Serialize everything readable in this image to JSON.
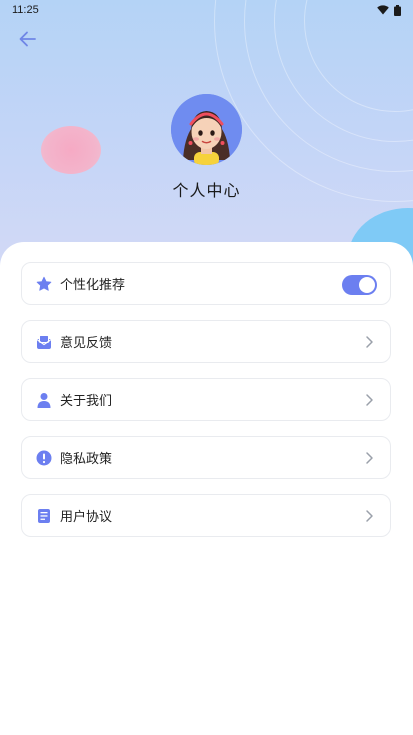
{
  "status_bar": {
    "time": "11:25"
  },
  "profile": {
    "title": "个人中心"
  },
  "menu": {
    "items": [
      {
        "label": "个性化推荐",
        "icon": "star-icon",
        "control": "toggle",
        "enabled": true
      },
      {
        "label": "意见反馈",
        "icon": "feedback-icon",
        "control": "chevron"
      },
      {
        "label": "关于我们",
        "icon": "user-icon",
        "control": "chevron"
      },
      {
        "label": "隐私政策",
        "icon": "info-icon",
        "control": "chevron"
      },
      {
        "label": "用户协议",
        "icon": "document-icon",
        "control": "chevron"
      }
    ]
  },
  "colors": {
    "accent": "#6c7ff0",
    "header_top": "#b4d3f6",
    "blob_pink": "#f3b4cb",
    "blob_blue": "#7fcaf6"
  }
}
